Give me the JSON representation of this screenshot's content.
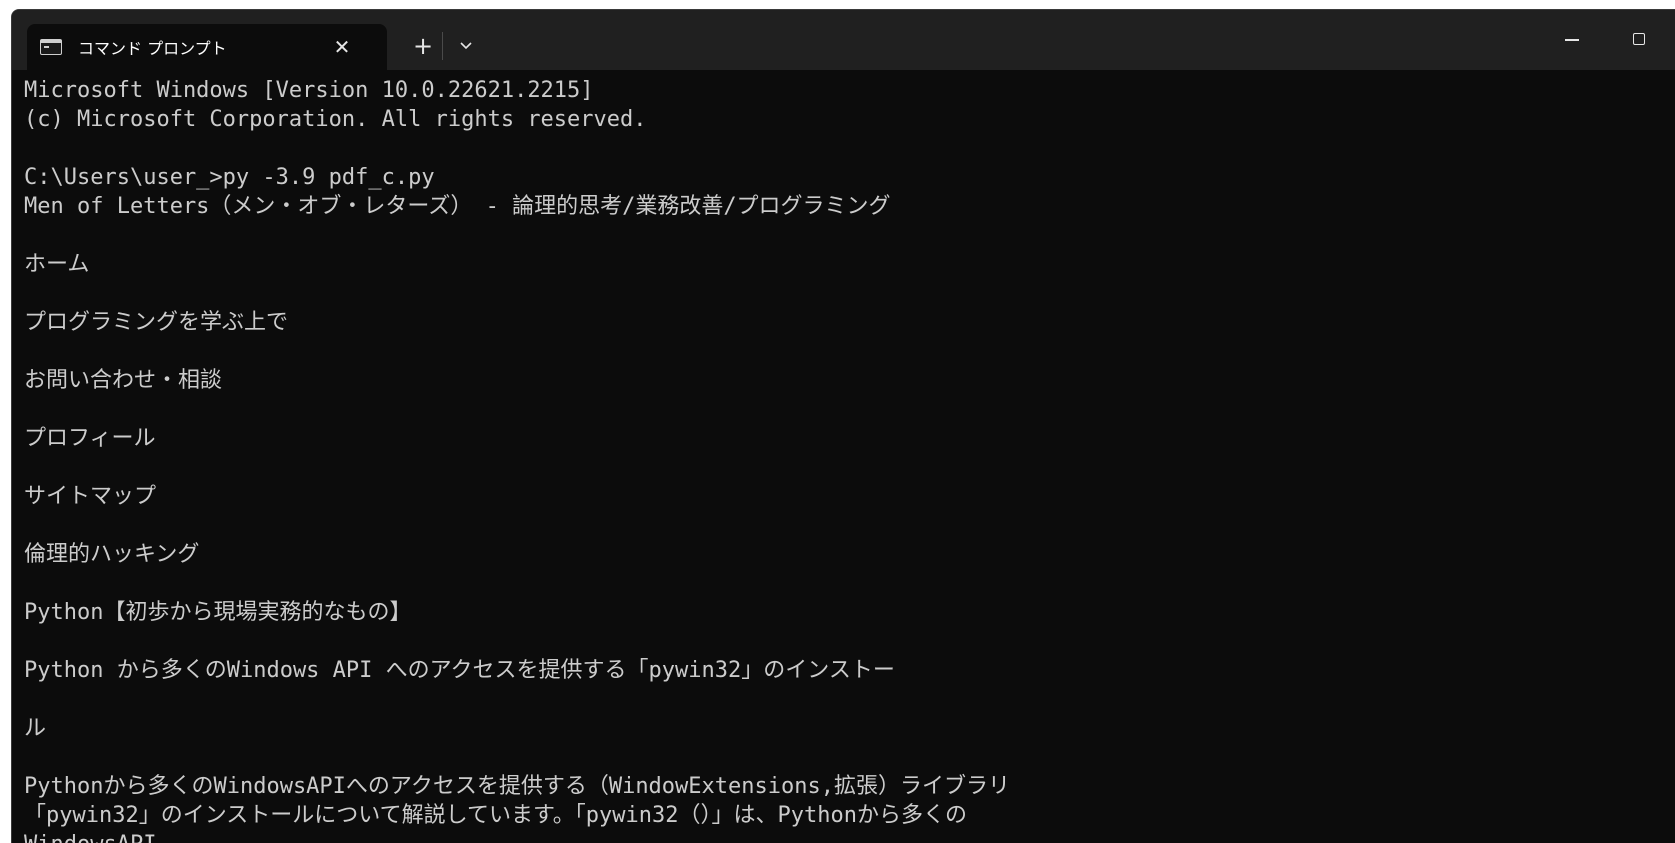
{
  "window": {
    "tab_title": "コマンド プロンプト",
    "tab_icon": "console-icon",
    "close_glyph": "✕",
    "new_tab_glyph": "+",
    "dropdown_glyph": "⌄"
  },
  "console": {
    "lines": [
      "Microsoft Windows [Version 10.0.22621.2215]",
      "(c) Microsoft Corporation. All rights reserved.",
      "",
      "C:\\Users\\user_>py -3.9 pdf_c.py",
      "Men of Letters（メン・オブ・レターズ） - 論理的思考/業務改善/プログラミング",
      "",
      "ホーム",
      "",
      "プログラミングを学ぶ上で",
      "",
      "お問い合わせ・相談",
      "",
      "プロフィール",
      "",
      "サイトマップ",
      "",
      "倫理的ハッキング",
      "",
      "Python【初歩から現場実務的なもの】",
      "",
      "Python から多くのWindows API へのアクセスを提供する「pywin32」のインストー",
      "",
      "ル",
      "",
      "Pythonから多くのWindowsAPIへのアクセスを提供する（WindowExtensions,拡張）ライブラリ",
      "「pywin32」のインストールについて解説しています。「pywin32（）」は、Pythonから多くの",
      "WindowsAPI"
    ]
  },
  "colors": {
    "background": "#0c0c0c",
    "titlebar": "#202020",
    "text": "#cccccc"
  }
}
